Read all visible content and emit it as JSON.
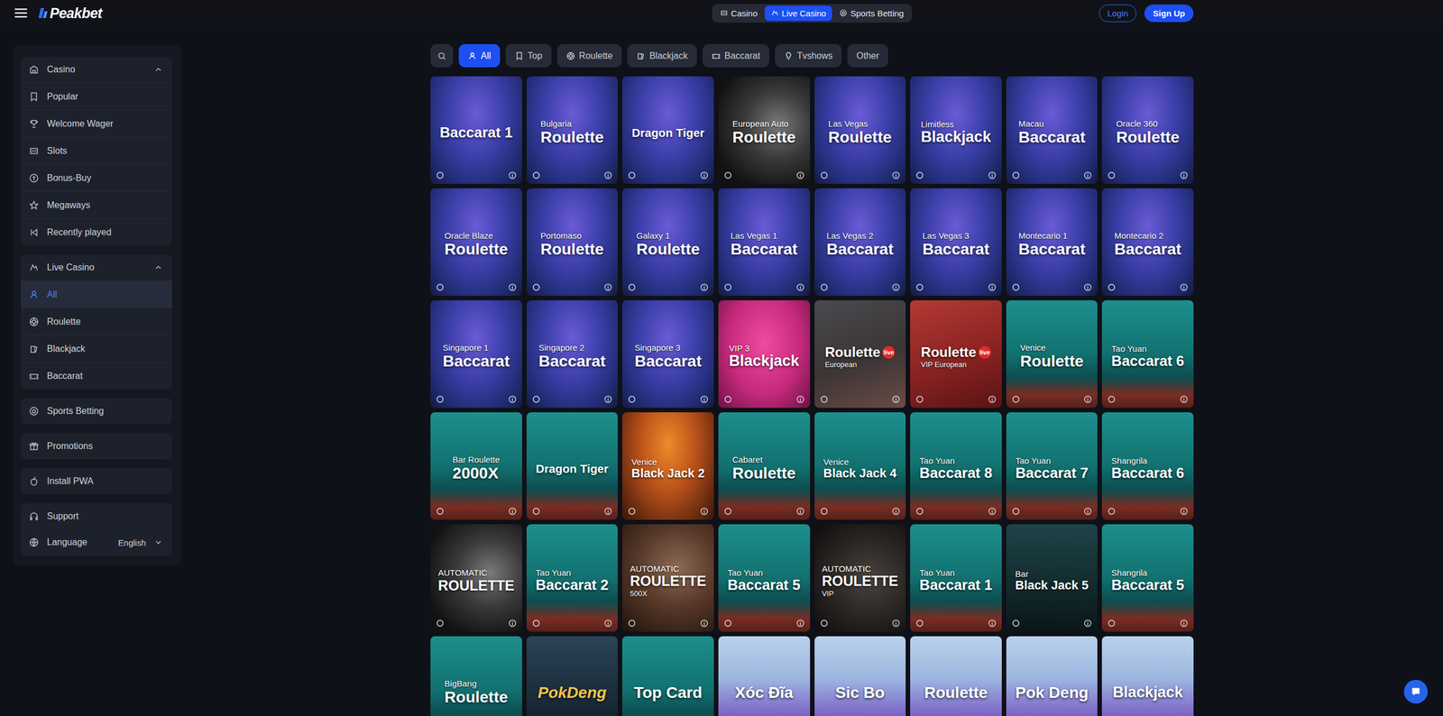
{
  "brand": {
    "name": "Peakbet"
  },
  "top_tabs": [
    {
      "label": "Casino",
      "selected": false
    },
    {
      "label": "Live Casino",
      "selected": true
    },
    {
      "label": "Sports Betting",
      "selected": false
    }
  ],
  "auth": {
    "login": "Login",
    "signup": "Sign Up"
  },
  "filters": [
    {
      "label": "All",
      "selected": true
    },
    {
      "label": "Top",
      "selected": false
    },
    {
      "label": "Roulette",
      "selected": false
    },
    {
      "label": "Blackjack",
      "selected": false
    },
    {
      "label": "Baccarat",
      "selected": false
    },
    {
      "label": "Tvshows",
      "selected": false
    },
    {
      "label": "Other",
      "selected": false
    }
  ],
  "sidebar": {
    "groups": [
      {
        "label": "Casino",
        "expanded": true,
        "items": [
          {
            "label": "Popular",
            "selected": false
          },
          {
            "label": "Welcome Wager",
            "selected": false
          },
          {
            "label": "Slots",
            "selected": false
          },
          {
            "label": "Bonus-Buy",
            "selected": false
          },
          {
            "label": "Megaways",
            "selected": false
          },
          {
            "label": "Recently played",
            "selected": false
          }
        ]
      },
      {
        "label": "Live Casino",
        "expanded": true,
        "items": [
          {
            "label": "All",
            "selected": true
          },
          {
            "label": "Roulette",
            "selected": false
          },
          {
            "label": "Blackjack",
            "selected": false
          },
          {
            "label": "Baccarat",
            "selected": false
          }
        ]
      }
    ],
    "links": [
      "Sports Betting",
      "Promotions",
      "Install PWA"
    ],
    "support": "Support",
    "language": {
      "label": "Language",
      "value": "English"
    }
  },
  "games": [
    {
      "sub": "",
      "title": "Baccarat 1",
      "badge": "",
      "note": "",
      "kind": "blue"
    },
    {
      "sub": "Bulgaria",
      "title": "Roulette",
      "badge": "",
      "note": "",
      "kind": "blue"
    },
    {
      "sub": "",
      "title": "Dragon Tiger",
      "badge": "",
      "note": "",
      "kind": "blue"
    },
    {
      "sub": "European Auto",
      "title": "Roulette",
      "badge": "",
      "note": "",
      "kind": "wheel"
    },
    {
      "sub": "Las Vegas",
      "title": "Roulette",
      "badge": "",
      "note": "",
      "kind": "blue"
    },
    {
      "sub": "Limitless",
      "title": "Blackjack",
      "badge": "",
      "note": "",
      "kind": "blue"
    },
    {
      "sub": "Macau",
      "title": "Baccarat",
      "badge": "",
      "note": "",
      "kind": "blue"
    },
    {
      "sub": "Oracle 360",
      "title": "Roulette",
      "badge": "",
      "note": "",
      "kind": "blue"
    },
    {
      "sub": "Oracle Blaze",
      "title": "Roulette",
      "badge": "",
      "note": "",
      "kind": "blue"
    },
    {
      "sub": "Portomaso",
      "title": "Roulette",
      "badge": "",
      "note": "",
      "kind": "blue"
    },
    {
      "sub": "Galaxy 1",
      "title": "Roulette",
      "badge": "",
      "note": "",
      "kind": "blue"
    },
    {
      "sub": "Las Vegas 1",
      "title": "Baccarat",
      "badge": "",
      "note": "",
      "kind": "blue"
    },
    {
      "sub": "Las Vegas 2",
      "title": "Baccarat",
      "badge": "",
      "note": "",
      "kind": "blue"
    },
    {
      "sub": "Las Vegas 3",
      "title": "Baccarat",
      "badge": "",
      "note": "",
      "kind": "blue"
    },
    {
      "sub": "Montecario 1",
      "title": "Baccarat",
      "badge": "",
      "note": "",
      "kind": "blue"
    },
    {
      "sub": "Montecario 2",
      "title": "Baccarat",
      "badge": "",
      "note": "",
      "kind": "blue"
    },
    {
      "sub": "Singapore 1",
      "title": "Baccarat",
      "badge": "",
      "note": "",
      "kind": "blue"
    },
    {
      "sub": "Singapore 2",
      "title": "Baccarat",
      "badge": "",
      "note": "",
      "kind": "blue"
    },
    {
      "sub": "Singapore 3",
      "title": "Baccarat",
      "badge": "",
      "note": "",
      "kind": "blue"
    },
    {
      "sub": "VIP 3",
      "title": "Blackjack",
      "badge": "",
      "note": "",
      "kind": "pink"
    },
    {
      "sub": "",
      "title": "Roulette",
      "badge": "live",
      "note": "European",
      "kind": "grey"
    },
    {
      "sub": "",
      "title": "Roulette",
      "badge": "live",
      "note": "VIP European",
      "kind": "red"
    },
    {
      "sub": "Venice",
      "title": "Roulette",
      "badge": "",
      "note": "",
      "kind": "teal"
    },
    {
      "sub": "Tao Yuan",
      "title": "Baccarat 6",
      "badge": "",
      "note": "",
      "kind": "teal"
    },
    {
      "sub": "Bar Roulette",
      "title": "2000X",
      "badge": "",
      "note": "",
      "kind": "teal"
    },
    {
      "sub": "",
      "title": "Dragon Tiger",
      "badge": "",
      "note": "",
      "kind": "teal"
    },
    {
      "sub": "Venice",
      "title": "Black Jack 2",
      "badge": "",
      "note": "",
      "kind": "orange"
    },
    {
      "sub": "Cabaret",
      "title": "Roulette",
      "badge": "",
      "note": "",
      "kind": "teal"
    },
    {
      "sub": "Venice",
      "title": "Black Jack 4",
      "badge": "",
      "note": "",
      "kind": "teal"
    },
    {
      "sub": "Tao Yuan",
      "title": "Baccarat 8",
      "badge": "",
      "note": "",
      "kind": "teal"
    },
    {
      "sub": "Tao Yuan",
      "title": "Baccarat 7",
      "badge": "",
      "note": "",
      "kind": "teal"
    },
    {
      "sub": "Shangrila",
      "title": "Baccarat 6",
      "badge": "",
      "note": "",
      "kind": "teal"
    },
    {
      "sub": "AUTOMATIC",
      "title": "ROULETTE",
      "badge": "",
      "note": "",
      "kind": "wheel"
    },
    {
      "sub": "Tao Yuan",
      "title": "Baccarat 2",
      "badge": "",
      "note": "",
      "kind": "teal"
    },
    {
      "sub": "AUTOMATIC",
      "title": "ROULETTE",
      "badge": "",
      "note": "500X",
      "kind": "copper"
    },
    {
      "sub": "Tao Yuan",
      "title": "Baccarat 5",
      "badge": "",
      "note": "",
      "kind": "teal"
    },
    {
      "sub": "AUTOMATIC",
      "title": "ROULETTE",
      "badge": "",
      "note": "VIP",
      "kind": "dark"
    },
    {
      "sub": "Tao Yuan",
      "title": "Baccarat 1",
      "badge": "",
      "note": "",
      "kind": "teal"
    },
    {
      "sub": "Bar",
      "title": "Black Jack 5",
      "badge": "",
      "note": "",
      "kind": "night"
    },
    {
      "sub": "Shangrila",
      "title": "Baccarat 5",
      "badge": "",
      "note": "",
      "kind": "teal"
    },
    {
      "sub": "BigBang",
      "title": "Roulette",
      "badge": "",
      "note": "",
      "kind": "teal"
    },
    {
      "sub": "",
      "title": "PokDeng",
      "badge": "",
      "note": "",
      "kind": "gold"
    },
    {
      "sub": "",
      "title": "Top Card",
      "badge": "",
      "note": "",
      "kind": "teal"
    },
    {
      "sub": "",
      "title": "Xóc Đĩa",
      "badge": "",
      "note": "",
      "kind": "lavender"
    },
    {
      "sub": "",
      "title": "Sic Bo",
      "badge": "",
      "note": "",
      "kind": "lavender"
    },
    {
      "sub": "",
      "title": "Roulette",
      "badge": "",
      "note": "",
      "kind": "lavender"
    },
    {
      "sub": "",
      "title": "Pok Deng",
      "badge": "",
      "note": "",
      "kind": "lavender"
    },
    {
      "sub": "",
      "title": "Blackjack",
      "badge": "",
      "note": "",
      "kind": "lavender"
    }
  ]
}
